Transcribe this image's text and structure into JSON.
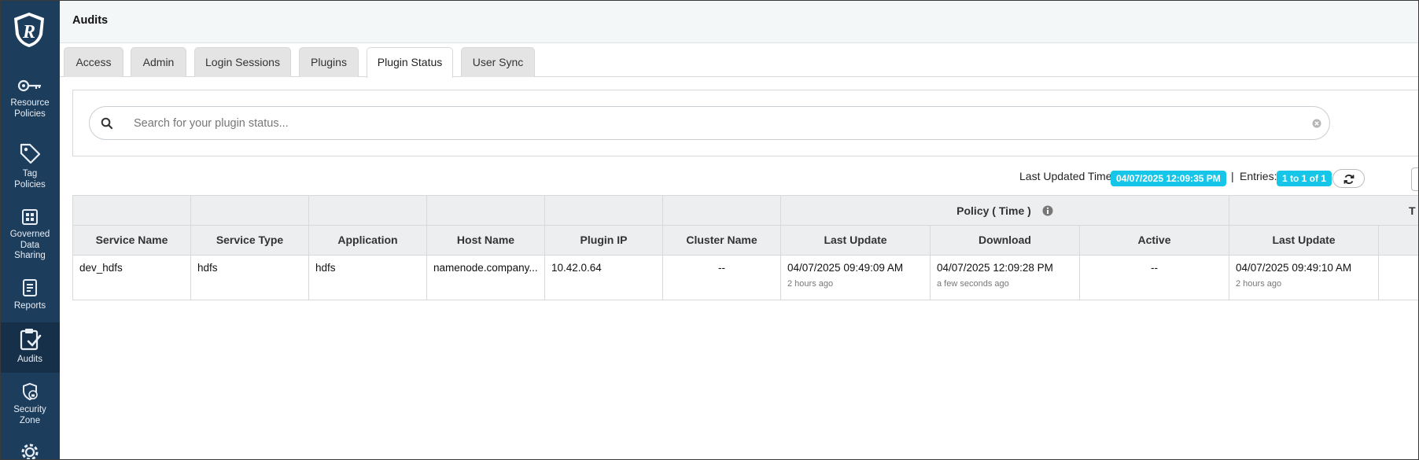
{
  "sidebar": {
    "colors": {
      "bg": "#1d3d5c",
      "active_bg": "#173049"
    },
    "logo_icon": "ranger-shield-logo",
    "items": [
      {
        "icon": "key-icon",
        "label_lines": [
          "Resource",
          "Policies"
        ]
      },
      {
        "icon": "tag-icon",
        "label_lines": [
          "Tag",
          "Policies"
        ]
      },
      {
        "icon": "grid-icon",
        "label_lines": [
          "Governed",
          "Data",
          "Sharing"
        ]
      },
      {
        "icon": "report-icon",
        "label_lines": [
          "Reports"
        ]
      },
      {
        "icon": "clipboard-check-icon",
        "label_lines": [
          "Audits"
        ],
        "active": true
      },
      {
        "icon": "shield-lock-icon",
        "label_lines": [
          "Security",
          "Zone"
        ]
      },
      {
        "icon": "gear-icon",
        "label_lines": []
      }
    ]
  },
  "header": {
    "title": "Audits"
  },
  "tabs": [
    {
      "label": "Access"
    },
    {
      "label": "Admin"
    },
    {
      "label": "Login Sessions"
    },
    {
      "label": "Plugins"
    },
    {
      "label": "Plugin Status",
      "active": true
    },
    {
      "label": "User Sync"
    }
  ],
  "search": {
    "placeholder": "Search for your plugin status...",
    "value": ""
  },
  "status": {
    "last_updated_label": "Last Updated Time:",
    "last_updated_value": "04/07/2025 12:09:35 PM",
    "separator": "|",
    "entries_label": "Entries:",
    "entries_value": "1 to 1 of 1",
    "badge_color": "#16c6e8"
  },
  "table": {
    "group_headers": {
      "policy": "Policy ( Time )",
      "tag_partial": "T"
    },
    "columns": [
      "Service Name",
      "Service Type",
      "Application",
      "Host Name",
      "Plugin IP",
      "Cluster Name",
      "Last Update",
      "Download",
      "Active",
      "Last Update"
    ],
    "rows": [
      {
        "service_name": "dev_hdfs",
        "service_type": "hdfs",
        "application": "hdfs",
        "host_name": "namenode.company...",
        "plugin_ip": "10.42.0.64",
        "cluster_name": "--",
        "policy_last_update": "04/07/2025 09:49:09 AM",
        "policy_last_update_rel": "2 hours ago",
        "policy_download": "04/07/2025 12:09:28 PM",
        "policy_download_rel": "a few seconds ago",
        "policy_active": "--",
        "tag_last_update": "04/07/2025 09:49:10 AM",
        "tag_last_update_rel": "2 hours ago"
      }
    ]
  }
}
